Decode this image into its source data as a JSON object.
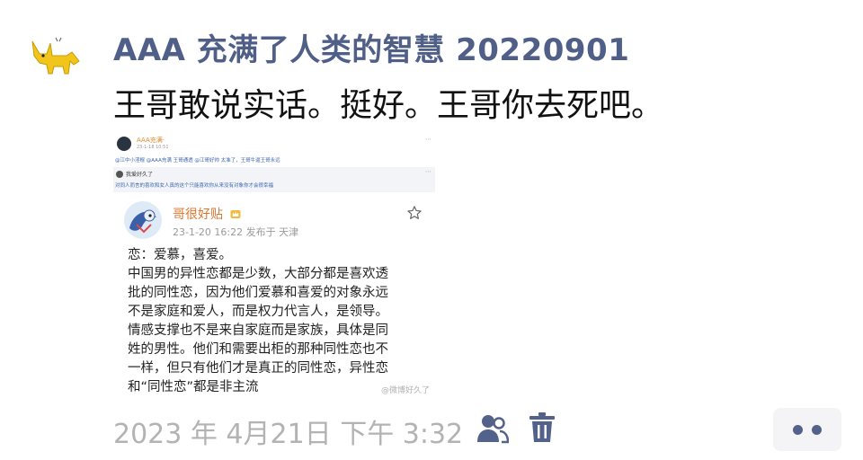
{
  "post": {
    "author": "AAA 充满了人类的智慧 20220901",
    "text": "王哥敢说实话。挺好。王哥你去死吧。"
  },
  "screenshot": {
    "top_post": {
      "name": "AAA充满·",
      "time": "23-1-18 10:51",
      "text": "@江中小淫棍 @AAA充满 王哥通透 @江哥好帅 太准了，王哥牛逼王哥永远"
    },
    "comment_band": {
      "name": "我爱好久了",
      "text": "对同人而言的喜欢和女人真的这个只能喜欢你从来没有对象你才会很幸福"
    },
    "card": {
      "name": "哥很好贴",
      "meta": "23-1-20 16:22  发布于 天津",
      "lines": [
        "恋：爱慕，喜爱。",
        "中国男的异性恋都是少数，大部分都是喜欢透",
        "批的同性恋，因为他们爱慕和喜爱的对象永远",
        "不是家庭和爱人，而是权力代言人，是领导。",
        "情感支撑也不是来自家庭而是家族，具体是同",
        "姓的男性。他们和需要出柜的那种同性恋也不",
        "一样，但只有他们才是真正的同性恋，异性恋",
        "和“同性恋”都是非主流"
      ],
      "watermark": "@微博好久了"
    }
  },
  "footer": {
    "time": "2023 年 4月21日  下午 3:32"
  },
  "icons": {
    "avatar": "yellow-cat-icon",
    "people": "people-icon",
    "trash": "trash-icon",
    "more": "more-dots-icon",
    "star": "star-icon",
    "badge": "crown-badge-icon"
  },
  "colors": {
    "author": "#4f5f87",
    "card_name": "#e0752e",
    "link": "#3a66b0",
    "footer": "#b3b3b3",
    "icon": "#53628a"
  }
}
